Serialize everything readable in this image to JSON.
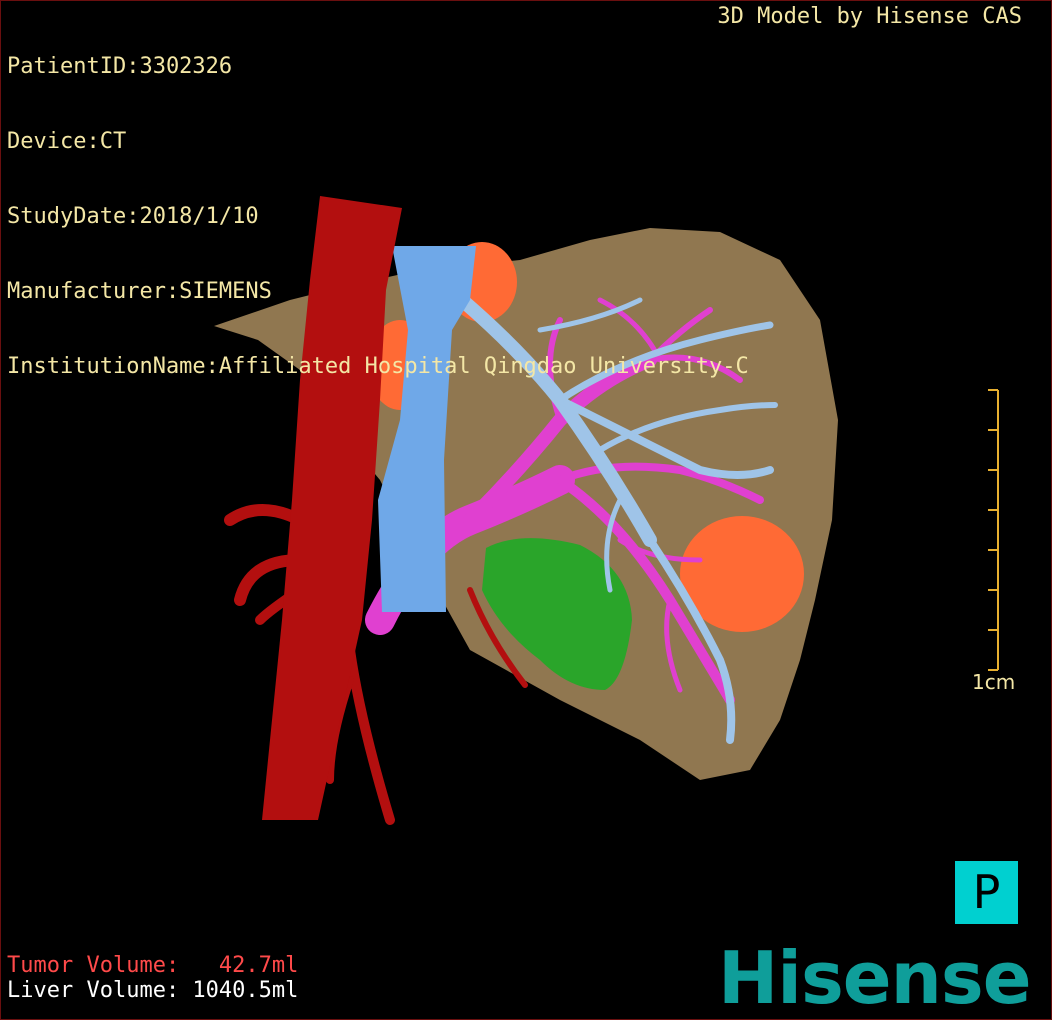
{
  "header": {
    "patient_id": "PatientID:3302326",
    "device": "Device:CT",
    "study_date": "StudyDate:2018/1/10",
    "manufacturer": "Manufacturer:SIEMENS",
    "institution": "InstitutionName:Affiliated Hospital Qingdao University-C"
  },
  "credit": "3D Model by Hisense CAS",
  "volumes": {
    "tumor": "Tumor Volume:   42.7ml",
    "liver": "Liver Volume: 1040.5ml"
  },
  "scale_bar": {
    "label": "1cm"
  },
  "orientation_badge": "P",
  "logo": "Hisense",
  "colors": {
    "info_text": "#f4e7a6",
    "tumor_text": "#ff4a4a",
    "liver": "#9c8157",
    "artery": "#b30f0f",
    "portal_vein": "#e040d0",
    "hepatic_vein": "#9fc4e8",
    "ivc": "#6fa8e8",
    "tumor": "#ff6a35",
    "gallbladder": "#2aa52a",
    "badge": "#00d0d0",
    "logo": "#0f9e9a"
  }
}
